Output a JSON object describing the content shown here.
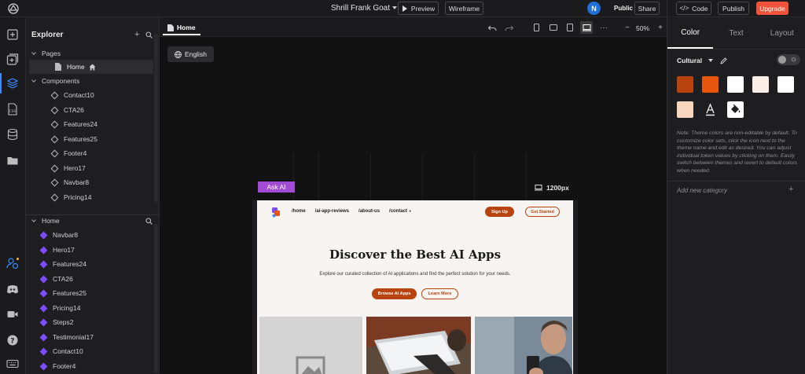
{
  "topbar": {
    "project_name": "Shrill Frank Goat",
    "preview_label": "Preview",
    "wireframe_label": "Wireframe",
    "avatar_initial": "N",
    "public_label": "Public",
    "share_label": "Share",
    "code_label": "Code",
    "publish_label": "Publish",
    "upgrade_label": "Upgrade",
    "upgrade_color": "#f0533a"
  },
  "rail": {
    "icons": [
      "plus-square-icon",
      "add-section-icon",
      "layers-icon",
      "css-icon",
      "database-icon",
      "folder-icon",
      "user-settings-icon",
      "discord-icon",
      "video-icon",
      "help-icon",
      "keyboard-icon"
    ]
  },
  "explorer": {
    "title": "Explorer",
    "pages_label": "Pages",
    "home_page": "Home",
    "components_label": "Components",
    "components": [
      "Contact10",
      "CTA26",
      "Features24",
      "Features25",
      "Footer4",
      "Hero17",
      "Navbar8",
      "Pricing14"
    ],
    "layers_root": "Home",
    "layers": [
      "Navbar8",
      "Hero17",
      "Features24",
      "CTA26",
      "Features25",
      "Pricing14",
      "Steps2",
      "Testimonial17",
      "Contact10",
      "Footer4"
    ]
  },
  "canvas": {
    "tab_label": "Home",
    "zoom": "50%",
    "language_label": "English",
    "ask_ai_label": "Ask AI",
    "breakpoint_label": "1200px",
    "more_label": "···",
    "zoom_minus": "−",
    "zoom_plus": "+"
  },
  "preview": {
    "nav": [
      "/home",
      "/ai-app-reviews",
      "/about-us",
      "/contact"
    ],
    "signup": "Sign Up",
    "get_started": "Get Started",
    "heading": "Discover the Best AI Apps",
    "subheading": "Explore our curated collection of AI applications and find the perfect solution for your needs.",
    "browse": "Browse AI Apps",
    "learn_more": "Learn More",
    "accent_color": "#b8430f"
  },
  "right_panel": {
    "tabs": [
      "Color",
      "Text",
      "Layout"
    ],
    "theme_name": "Cultural",
    "swatches": [
      "#b8430f",
      "#e8550d",
      "#ffffff",
      "#fbeee6",
      "#ffffff",
      "#f7d6bd"
    ],
    "note": "Note: Theme colors are non-editable by default. To customize color sets, click the icon next to the theme name and edit as desired. You can adjust individual token values by clicking on them. Easily switch between themes and revert to default colors when needed.",
    "add_category": "Add new category",
    "add_plus": "+"
  }
}
